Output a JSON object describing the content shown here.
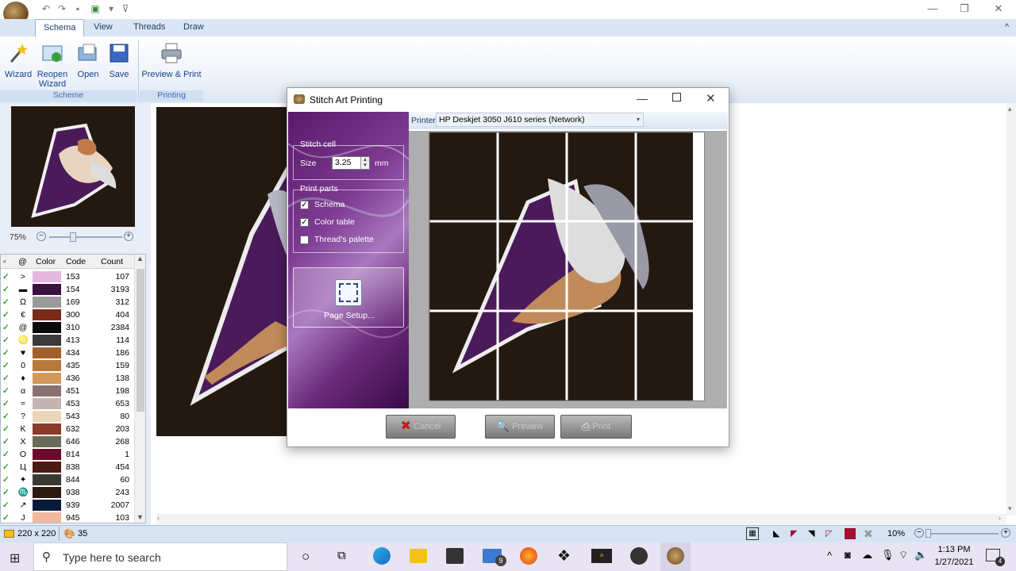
{
  "app": {
    "tabs": [
      "Schema",
      "View",
      "Threads",
      "Draw"
    ],
    "ribbon": {
      "buttons": [
        {
          "label": "Wizard",
          "icon": "wand-icon"
        },
        {
          "label": "Reopen Wizard",
          "icon": "reopen-wizard-icon"
        },
        {
          "label": "Open",
          "icon": "open-folder-icon"
        },
        {
          "label": "Save",
          "icon": "floppy-disk-icon"
        },
        {
          "label": "Preview & Print",
          "icon": "printer-icon"
        }
      ],
      "groups": [
        "Scheme",
        "Printing"
      ]
    }
  },
  "left_panel": {
    "zoom": "75%",
    "table_headers": [
      "@",
      "Color",
      "Code",
      "Count"
    ],
    "rows": [
      {
        "sym": ">",
        "color": "#e6b8e0",
        "code": "153",
        "count": "107"
      },
      {
        "sym": "▬",
        "color": "#3a1240",
        "code": "154",
        "count": "3193"
      },
      {
        "sym": "Ω",
        "color": "#9a9a9a",
        "code": "169",
        "count": "312"
      },
      {
        "sym": "€",
        "color": "#7a2a1a",
        "code": "300",
        "count": "404"
      },
      {
        "sym": "@",
        "color": "#0a0a0a",
        "code": "310",
        "count": "2384"
      },
      {
        "sym": "♌",
        "color": "#3a3a3a",
        "code": "413",
        "count": "114"
      },
      {
        "sym": "♥",
        "color": "#a0602a",
        "code": "434",
        "count": "186"
      },
      {
        "sym": "0",
        "color": "#b8783a",
        "code": "435",
        "count": "159"
      },
      {
        "sym": "♦",
        "color": "#d09a5a",
        "code": "436",
        "count": "138"
      },
      {
        "sym": "α",
        "color": "#8a7070",
        "code": "451",
        "count": "198"
      },
      {
        "sym": "≈",
        "color": "#c4b4b4",
        "code": "453",
        "count": "653"
      },
      {
        "sym": "?",
        "color": "#ecd6b8",
        "code": "543",
        "count": "80"
      },
      {
        "sym": "K",
        "color": "#8a3a2a",
        "code": "632",
        "count": "203"
      },
      {
        "sym": "X",
        "color": "#6a6a5a",
        "code": "646",
        "count": "268"
      },
      {
        "sym": "O",
        "color": "#6a0a2a",
        "code": "814",
        "count": "1"
      },
      {
        "sym": "Ц",
        "color": "#4a1a14",
        "code": "838",
        "count": "454"
      },
      {
        "sym": "✦",
        "color": "#3a3a34",
        "code": "844",
        "count": "60"
      },
      {
        "sym": "♏",
        "color": "#2a1a12",
        "code": "938",
        "count": "243"
      },
      {
        "sym": "↗",
        "color": "#0a1a3a",
        "code": "939",
        "count": "2007"
      },
      {
        "sym": "J",
        "color": "#f0b8a0",
        "code": "945",
        "count": "103"
      }
    ]
  },
  "status": {
    "size": "220 x 220",
    "colors": "35",
    "zoom": "10%"
  },
  "dialog": {
    "title": "Stitch Art Printing",
    "stitch_cell": "Stitch cell",
    "size_label": "Size",
    "size_value": "3.25",
    "size_unit": "mm",
    "print_parts": "Print parts",
    "parts": [
      {
        "label": "Schema",
        "checked": true
      },
      {
        "label": "Color table",
        "checked": true
      },
      {
        "label": "Thread's palette",
        "checked": false
      }
    ],
    "page_setup": "Page Setup...",
    "printer_label": "Printer",
    "printer_value": "HP Deskjet 3050 J610 series (Network)",
    "buttons": [
      "Cancel",
      "Preview",
      "Print"
    ]
  },
  "taskbar": {
    "search_placeholder": "Type here to search",
    "time": "1:13 PM",
    "date": "1/27/2021",
    "notifications": "4",
    "mail_badge": "9"
  }
}
